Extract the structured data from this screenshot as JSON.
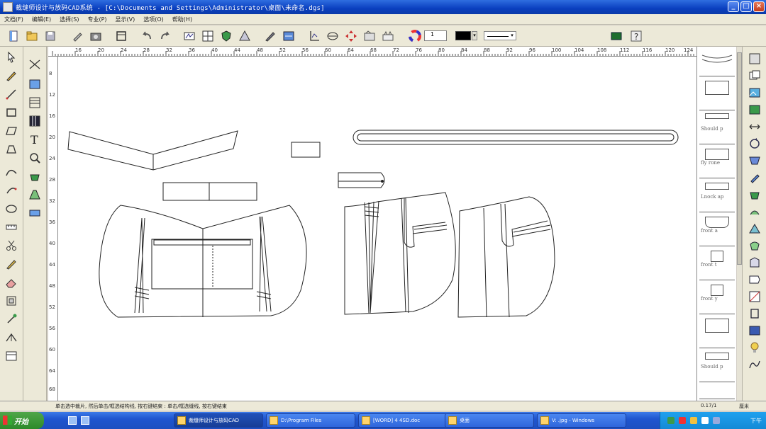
{
  "window": {
    "title": "裁缝师设计与放码CAD系统 - [C:\\Documents and Settings\\Administrator\\桌面\\未命名.dgs]"
  },
  "menu": [
    "文档(F)",
    "编辑(E)",
    "选择(S)",
    "专业(P)",
    "显示(V)",
    "选项(O)",
    "帮助(H)"
  ],
  "toolbar": {
    "line_width_value": "1"
  },
  "rulers": {
    "horizontal": [
      "16",
      "20",
      "24",
      "28",
      "32",
      "36",
      "40",
      "44",
      "48",
      "52",
      "56",
      "60",
      "64",
      "68",
      "72",
      "76",
      "80",
      "84",
      "88",
      "92",
      "96",
      "100",
      "104",
      "108",
      "112",
      "116",
      "120",
      "124"
    ],
    "vertical": [
      "8",
      "12",
      "16",
      "20",
      "24",
      "28",
      "32",
      "36",
      "40",
      "44",
      "48",
      "52",
      "56",
      "60",
      "64",
      "68"
    ]
  },
  "panel": {
    "thumbs": [
      "",
      "",
      "Should p",
      "fly rone",
      "Lnock ap",
      "front a",
      "front t",
      "front y",
      "",
      "Should p",
      ""
    ]
  },
  "status": {
    "message": "单击选中裁片, 然后单击/框选结构线, 按右键结束 : 单击/框选缝线, 按右键结束",
    "coord": "0.17/1",
    "unit": "厘米"
  },
  "taskbar": {
    "start": "开始",
    "tasks": [
      {
        "label": "裁缝师设计与放码CAD"
      },
      {
        "label": "D:\\Program Files"
      },
      {
        "label": "[WORD] 4 4SD.doc"
      },
      {
        "label": "桌面"
      },
      {
        "label": "V: .jpg - Windows"
      }
    ],
    "clock": "下午"
  },
  "colors": {
    "title_bar": "#0a3fbf",
    "menu_bg": "#ece9d8",
    "canvas_bg": "#ffffff",
    "taskbar": "#1f55cf",
    "start_button": "#2d8a2a"
  }
}
